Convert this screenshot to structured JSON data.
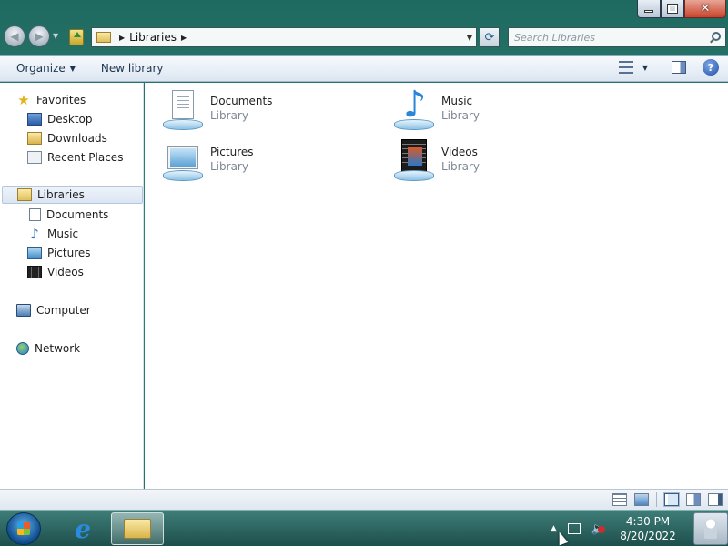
{
  "window": {
    "caption_buttons": [
      "minimize",
      "maximize",
      "close"
    ]
  },
  "address_bar": {
    "breadcrumb": [
      "Libraries"
    ]
  },
  "search": {
    "placeholder": "Search Libraries"
  },
  "toolbar": {
    "organize_label": "Organize",
    "new_library_label": "New library"
  },
  "nav_pane": {
    "favorites": {
      "label": "Favorites",
      "items": [
        {
          "label": "Desktop",
          "icon": "desktop-icon"
        },
        {
          "label": "Downloads",
          "icon": "downloads-folder-icon"
        },
        {
          "label": "Recent Places",
          "icon": "recent-places-icon"
        }
      ]
    },
    "libraries": {
      "label": "Libraries",
      "selected": true,
      "items": [
        {
          "label": "Documents",
          "icon": "documents-icon"
        },
        {
          "label": "Music",
          "icon": "music-icon"
        },
        {
          "label": "Pictures",
          "icon": "pictures-icon"
        },
        {
          "label": "Videos",
          "icon": "videos-icon"
        }
      ]
    },
    "computer": {
      "label": "Computer"
    },
    "network": {
      "label": "Network"
    }
  },
  "content": {
    "items": [
      {
        "name": "Documents",
        "type": "Library",
        "icon": "documents-library-icon"
      },
      {
        "name": "Music",
        "type": "Library",
        "icon": "music-library-icon"
      },
      {
        "name": "Pictures",
        "type": "Library",
        "icon": "pictures-library-icon"
      },
      {
        "name": "Videos",
        "type": "Library",
        "icon": "videos-library-icon"
      }
    ]
  },
  "taskbar": {
    "clock_time": "4:30 PM",
    "clock_date": "8/20/2022"
  }
}
